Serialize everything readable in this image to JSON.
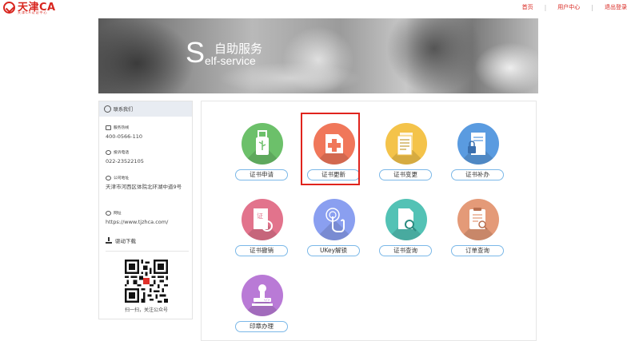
{
  "header": {
    "logo_text": "天津CA",
    "logo_sub": "天津CA认证中心",
    "nav": [
      "首页",
      "用户中心",
      "退出登录"
    ]
  },
  "banner": {
    "big_letter": "S",
    "title_cn": "自助服务",
    "title_en": "elf-service"
  },
  "sidebar": {
    "heading": "联系我们",
    "hotline_label": "服务热线",
    "hotline_value": "400-0566-110",
    "complaint_label": "投诉电话",
    "complaint_value": "022-23522105",
    "address_label": "公司地址",
    "address_value": "天津市河西区体院北环湖中道9号",
    "website_label": "网址",
    "website_value": "https://www.tjzhca.com/",
    "download_label": "驱动下载",
    "qr_caption": "扫一扫，关注公众号"
  },
  "services": [
    {
      "label": "证书申请",
      "color": "#6cc06a",
      "icon": "usb-key-icon"
    },
    {
      "label": "证书更新",
      "color": "#f0775a",
      "icon": "certificate-plus-icon"
    },
    {
      "label": "证书变更",
      "color": "#f4c34a",
      "icon": "documents-icon"
    },
    {
      "label": "证书补办",
      "color": "#5a9be0",
      "icon": "document-lock-icon"
    },
    {
      "label": "证书撤销",
      "color": "#e2738c",
      "icon": "certificate-power-icon"
    },
    {
      "label": "UKey解锁",
      "color": "#8a9ff0",
      "icon": "fingerprint-touch-icon"
    },
    {
      "label": "证书查询",
      "color": "#53c2b5",
      "icon": "document-search-icon"
    },
    {
      "label": "订单查询",
      "color": "#e49a78",
      "icon": "clipboard-search-icon"
    },
    {
      "label": "印章办理",
      "color": "#b97ad6",
      "icon": "seal-stamp-icon"
    }
  ],
  "highlighted_service": "证书更新"
}
